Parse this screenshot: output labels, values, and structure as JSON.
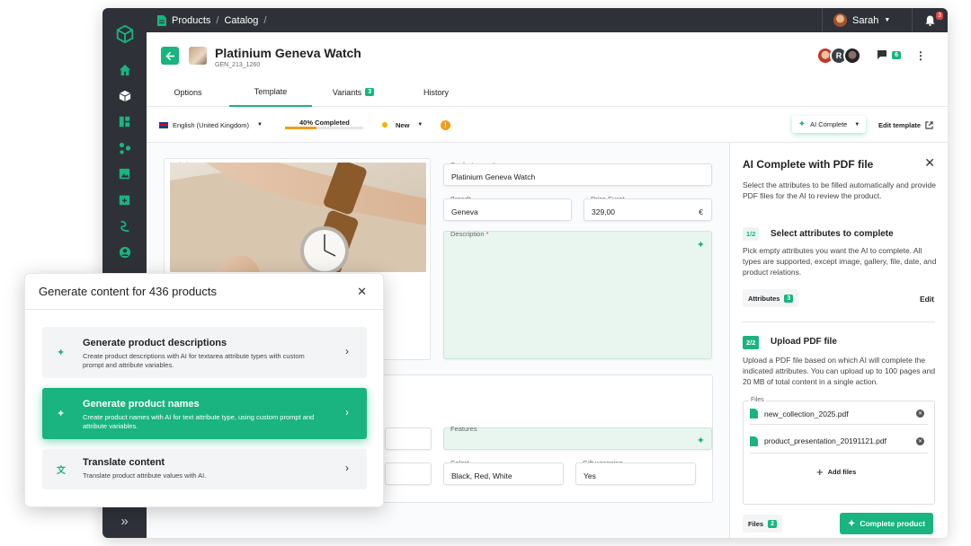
{
  "topbar": {
    "crumb1": "Products",
    "sep": "/",
    "crumb2": "Catalog",
    "sep2": "/",
    "user": "Sarah",
    "notif_count": "3"
  },
  "product": {
    "title": "Platinium Geneva Watch",
    "code": "GEN_213_1260",
    "comments_count": "6",
    "avatar_letter": "R"
  },
  "tabs": [
    {
      "label": "Options"
    },
    {
      "label": "Template"
    },
    {
      "label": "Variants",
      "badge": "3"
    },
    {
      "label": "History"
    }
  ],
  "toolbar": {
    "language": "English (United Kingdom)",
    "progress_label": "40% Completed",
    "progress": 0.4,
    "status": "New",
    "ai_button": "AI Complete",
    "edit_template": "Edit template"
  },
  "form": {
    "main_image_label": "Main image",
    "product_name_label": "Product name",
    "product_name_value": "Platinium Geneva Watch",
    "brand_label": "Brand",
    "brand_value": "Geneva",
    "price_label": "Price Euro",
    "price_value": "329,00",
    "currency": "€",
    "description_label": "Description",
    "features_label": "Features",
    "color_label": "Color",
    "color_value": "Black, Red, White",
    "gift_label": "Gift-wrapping",
    "gift_value": "Yes",
    "required_mark": "*"
  },
  "panel": {
    "title": "AI Complete with PDF file",
    "intro": "Select the attributes to be filled automatically and provide PDF files for the AI to review the product.",
    "step1_num": "1/2",
    "step1_title": "Select attributes to complete",
    "step1_desc": "Pick empty attributes you want the AI to complete. All types are supported, except image, gallery, file, date, and product relations.",
    "attributes_label": "Attributes",
    "attributes_count": "3",
    "edit_label": "Edit",
    "step2_num": "2/2",
    "step2_title": "Upload PDF file",
    "step2_desc": "Upload a PDF file based on which AI will complete the indicated attributes. You can upload up to 100 pages and 20 MB of total content in a single action.",
    "files_label": "Files",
    "files": [
      "new_collection_2025.pdf",
      "product_presentation_20191121.pdf"
    ],
    "add_files": "Add files",
    "footer_files": "Files",
    "footer_files_count": "2",
    "complete_button": "Complete product"
  },
  "modal": {
    "title": "Generate content for 436 products",
    "options": [
      {
        "title": "Generate product descriptions",
        "desc": "Create product descriptions with AI for textarea attribute types with custom prompt and attribute variables."
      },
      {
        "title": "Generate product names",
        "desc": "Create product names with AI for text attribute type, using custom prompt and attribute variables."
      },
      {
        "title": "Translate content",
        "desc": "Translate product attribute values with AI."
      }
    ]
  },
  "colors": {
    "accent": "#19b47f",
    "sidebar": "#2e3238",
    "progress": "#f29b1d",
    "status_dot": "#f2b200",
    "warning": "#f29b1d"
  }
}
